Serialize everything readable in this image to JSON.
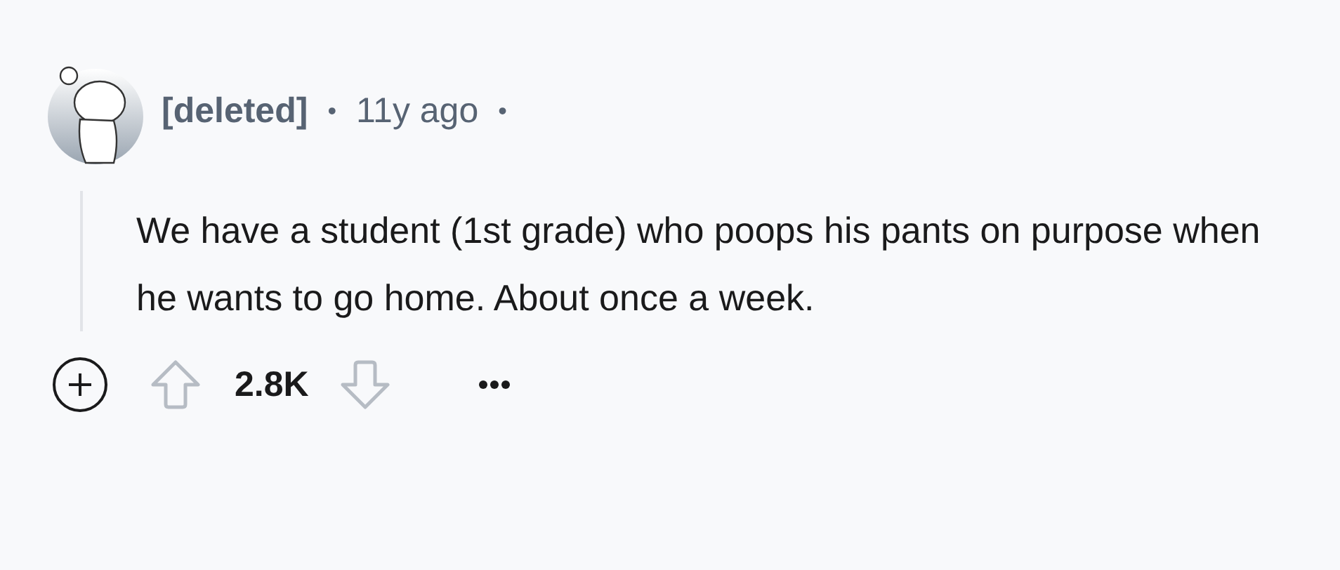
{
  "comment": {
    "author": "[deleted]",
    "separator": "•",
    "age": "11y ago",
    "trailing_separator": "•",
    "body": "We have a student (1st grade) who poops his pants on purpose when he wants to go home. About once a week."
  },
  "actions": {
    "score": "2.8K"
  }
}
